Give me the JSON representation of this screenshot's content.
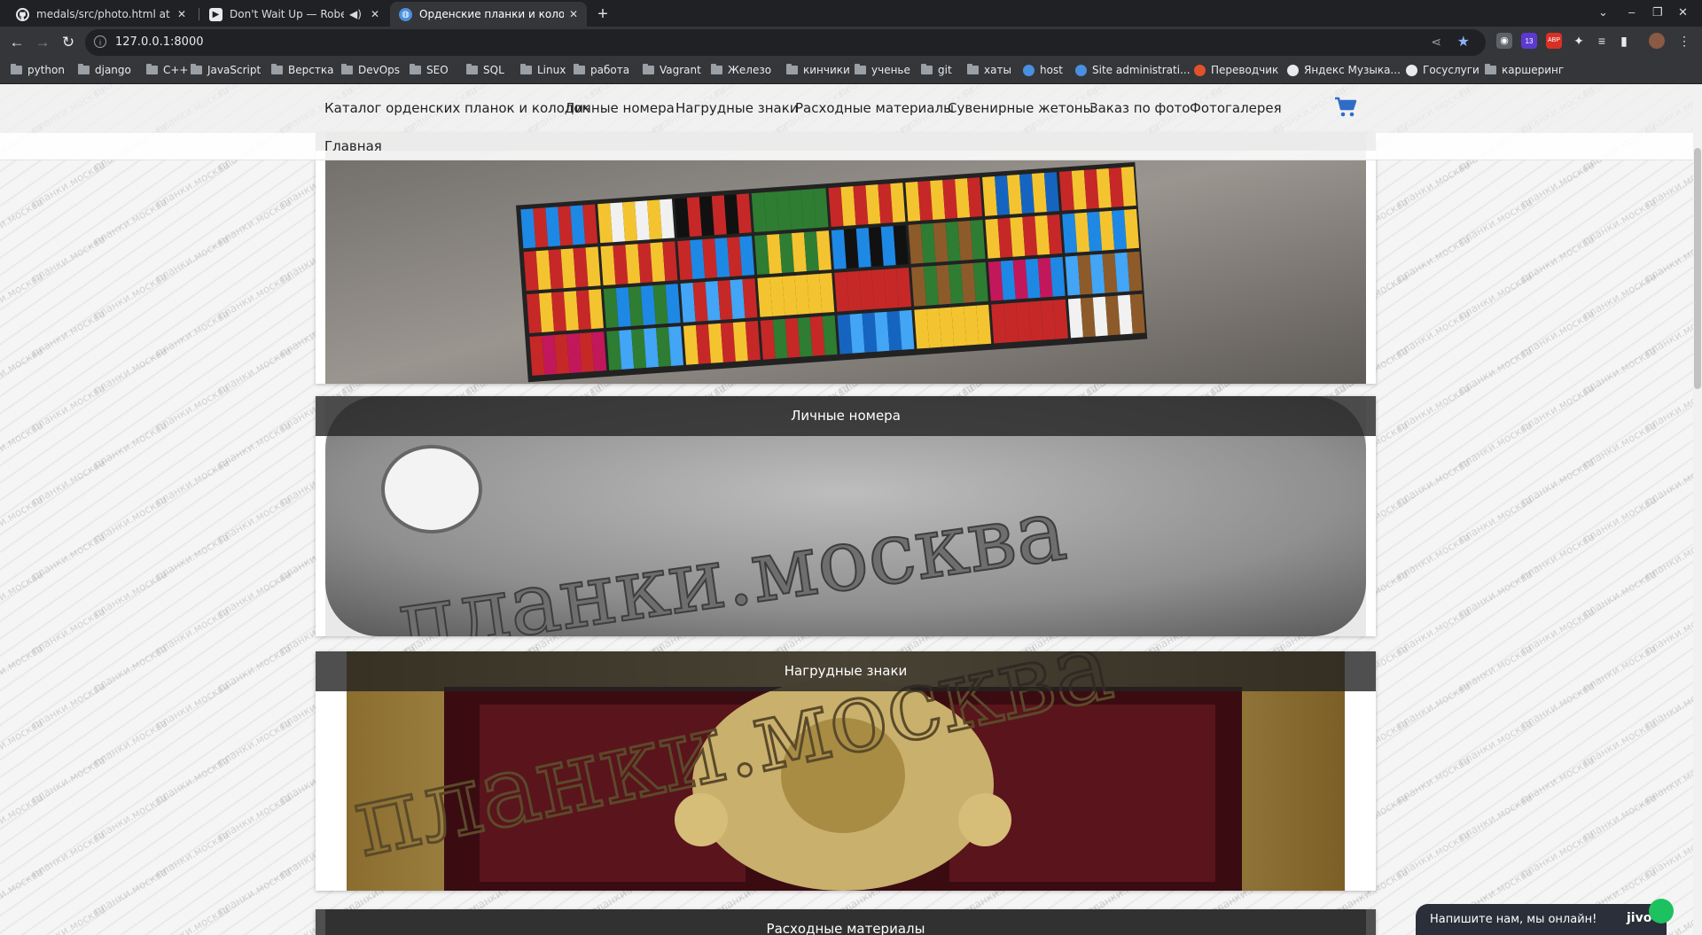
{
  "browser": {
    "tabs": [
      {
        "title": "medals/src/photo.html at ma",
        "favicon": "github-icon"
      },
      {
        "title": "Don't Wait Up — Robert",
        "favicon": "youtube-music-icon"
      },
      {
        "title": "Орденские планки и колод",
        "favicon": "globe-icon",
        "active": true
      }
    ],
    "url": "127.0.0.1:8000",
    "ext_badge_1": "13",
    "ext_badge_2": "ABP",
    "bookmarks": [
      {
        "label": "python",
        "type": "folder"
      },
      {
        "label": "django",
        "type": "folder"
      },
      {
        "label": "C++",
        "type": "folder"
      },
      {
        "label": "JavaScript",
        "type": "folder"
      },
      {
        "label": "Верстка",
        "type": "folder"
      },
      {
        "label": "DevOps",
        "type": "folder"
      },
      {
        "label": "SEO",
        "type": "folder"
      },
      {
        "label": "SQL",
        "type": "folder"
      },
      {
        "label": "Linux",
        "type": "folder"
      },
      {
        "label": "работа",
        "type": "folder"
      },
      {
        "label": "Vagrant",
        "type": "folder"
      },
      {
        "label": "Железо",
        "type": "folder"
      },
      {
        "label": "кинчики",
        "type": "folder"
      },
      {
        "label": "ученье",
        "type": "folder"
      },
      {
        "label": "git",
        "type": "folder"
      },
      {
        "label": "хаты",
        "type": "folder"
      },
      {
        "label": "host",
        "type": "site"
      },
      {
        "label": "Site administrati...",
        "type": "site"
      },
      {
        "label": "Переводчик",
        "type": "site"
      },
      {
        "label": "Яндекс Музыка...",
        "type": "site"
      },
      {
        "label": "Госуслуги",
        "type": "site"
      },
      {
        "label": "каршеринг",
        "type": "folder"
      }
    ]
  },
  "site": {
    "nav": [
      "Каталог орденских планок и колодок",
      "Личные номера",
      "Нагрудные знаки",
      "Расходные материалы",
      "Сувенирные жетоны",
      "Заказ по фото",
      "Фотогалерея"
    ],
    "breadcrumb": "Главная",
    "watermark": "планки.москва",
    "cards": [
      {
        "caption": "",
        "image": "ribbon-bars-photo"
      },
      {
        "caption": "Личные номера",
        "image": "dog-tag-photo"
      },
      {
        "caption": "Нагрудные знаки",
        "image": "breast-badge-photo"
      },
      {
        "caption": "Расходные материалы",
        "image": "materials-photo"
      }
    ],
    "chat": {
      "text": "Напишите нам, мы онлайн!",
      "brand": "jivo"
    }
  },
  "colors": {
    "chrome_dark": "#202124",
    "chrome_toolbar": "#35363a",
    "cart_blue": "#2f6cc6",
    "chat_bg": "#2a2f3a",
    "chat_green": "#1ec15f"
  }
}
